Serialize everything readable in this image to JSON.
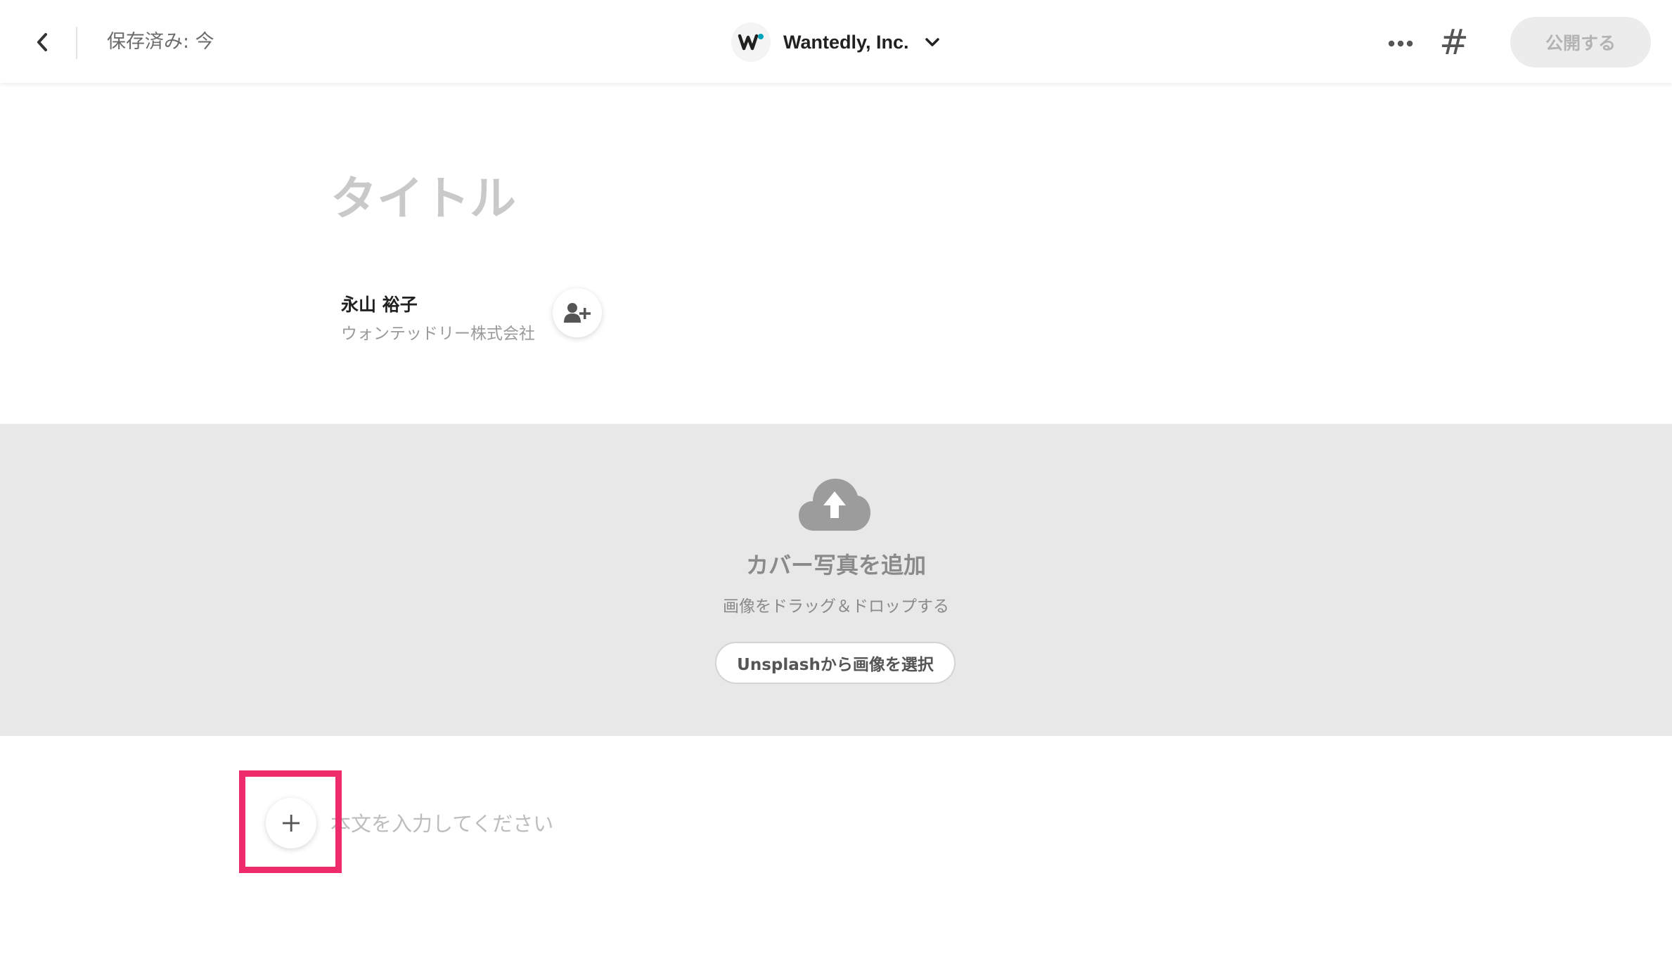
{
  "header": {
    "save_status": "保存済み: 今",
    "company_name": "Wantedly, Inc.",
    "publish_label": "公開する",
    "hashtag_symbol": "#"
  },
  "post": {
    "title_placeholder": "タイトル",
    "author_name": "永山 裕子",
    "author_company": "ウォンテッドリー株式会社",
    "body_placeholder": "本文を入力してください"
  },
  "cover": {
    "title": "カバー写真を追加",
    "subtitle": "画像をドラッグ＆ドロップする",
    "unsplash_label": "Unsplashから画像を選択"
  },
  "icons": {
    "back": "chevron-left-icon",
    "logo": "wantedly-logo",
    "dropdown": "chevron-down-icon",
    "more": "ellipsis-icon",
    "hashtag": "hashtag-icon",
    "add_author": "user-plus-icon",
    "upload": "cloud-upload-icon",
    "insert": "plus-icon"
  },
  "colors": {
    "highlight": "#ee2c6b",
    "brand_dot": "#00a4bb",
    "cover_bg": "#e8e8e8"
  }
}
